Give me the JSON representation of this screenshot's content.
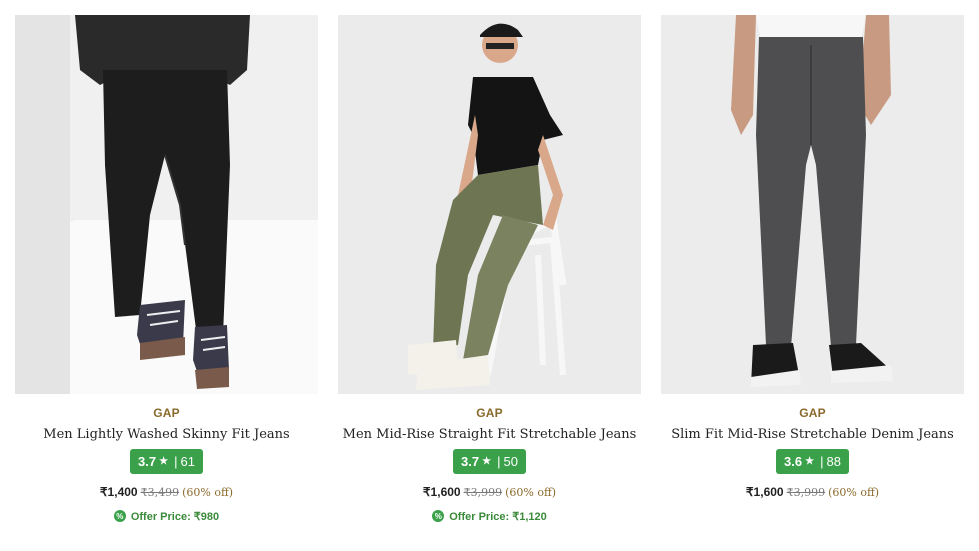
{
  "products": [
    {
      "image_alt": "",
      "brand": "GAP",
      "name": "Men Lightly Washed Skinny Fit Jeans",
      "rating": "3.7",
      "rating_count": "61",
      "price": "₹1,400",
      "mrp": "₹3,499",
      "discount": "(60% off)",
      "offer_label": "Offer Price: ₹980"
    },
    {
      "image_alt": "",
      "brand": "GAP",
      "name": "Men Mid-Rise Straight Fit Stretchable Jeans",
      "rating": "3.7",
      "rating_count": "50",
      "price": "₹1,600",
      "mrp": "₹3,999",
      "discount": "(60% off)",
      "offer_label": "Offer Price: ₹1,120"
    },
    {
      "image_alt": "",
      "brand": "GAP",
      "name": "Slim Fit Mid-Rise Stretchable Denim Jeans",
      "rating": "3.6",
      "rating_count": "88",
      "price": "₹1,600",
      "mrp": "₹3,999",
      "discount": "(60% off)",
      "offer_label": ""
    }
  ],
  "icons": {
    "rating_star": "star-icon",
    "offer": "offer-tag-icon"
  },
  "colors": {
    "rating_badge": "#3aa04a",
    "brand": "#8a6a2c",
    "offer_text": "#3a8a3a"
  }
}
